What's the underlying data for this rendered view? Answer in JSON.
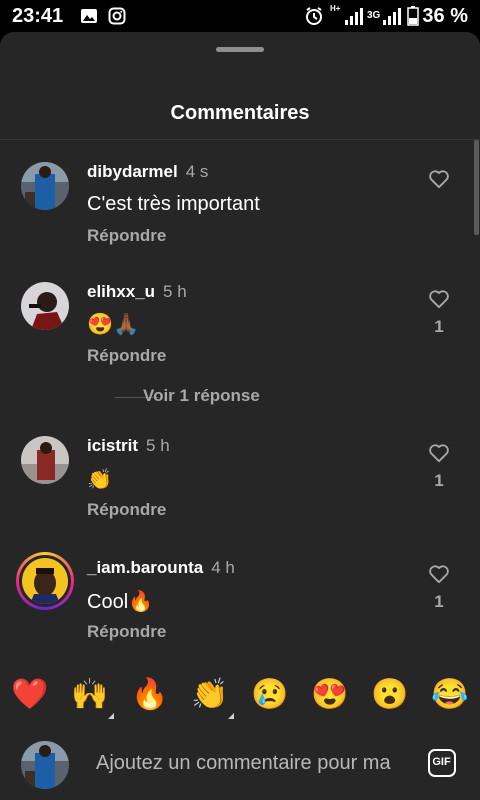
{
  "status_bar": {
    "time": "23:41",
    "battery": "36 %",
    "network": "3G",
    "signal_label": "H+"
  },
  "sheet": {
    "title": "Commentaires"
  },
  "comments": [
    {
      "username": "dibydarmel",
      "time": "4 s",
      "text": "C'est très important",
      "reply": "Répondre",
      "likes": ""
    },
    {
      "username": "elihxx_u",
      "time": "5 h",
      "text": "😍🙏🏾",
      "reply": "Répondre",
      "likes": "1"
    },
    {
      "username": "icistrit",
      "time": "5 h",
      "text": "👏",
      "reply": "Répondre",
      "likes": "1"
    },
    {
      "username": "_iam.barounta",
      "time": "4 h",
      "text": "Cool🔥",
      "reply": "Répondre",
      "likes": "1"
    }
  ],
  "view_replies": "Voir 1 réponse",
  "emoji_bar": [
    "❤️",
    "🙌",
    "🔥",
    "👏",
    "😢",
    "😍",
    "😮",
    "😂"
  ],
  "composer": {
    "placeholder": "Ajoutez un commentaire pour ma",
    "gif": "GIF"
  },
  "colors": {
    "sheet_bg": "#262626",
    "secondary_text": "#a8a8a8"
  }
}
